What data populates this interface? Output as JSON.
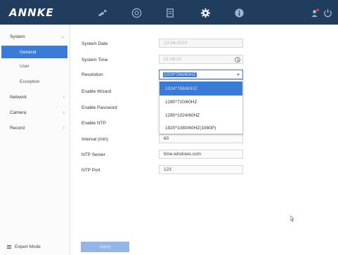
{
  "header": {
    "logo": "ANNKE",
    "icons": [
      "live-view-icon",
      "playback-icon",
      "file-icon",
      "settings-icon",
      "info-icon",
      "user-icon",
      "power-icon"
    ],
    "bg_color": "#203d5e",
    "active_icon": "settings-icon"
  },
  "sidebar": {
    "groups": [
      {
        "label": "System",
        "expanded": true
      },
      {
        "label": "Network",
        "expanded": false
      },
      {
        "label": "Camera",
        "expanded": false
      },
      {
        "label": "Record",
        "expanded": false
      }
    ],
    "system_items": [
      "General",
      "User",
      "Exception"
    ],
    "active_item": "General",
    "expert_mode": "Expert Mode",
    "accent": "#3a7bd5"
  },
  "form": {
    "system_date": {
      "label": "System Date",
      "value": "23-04-2020"
    },
    "system_time": {
      "label": "System Time",
      "value": "01:08:32"
    },
    "resolution": {
      "label": "Resolution",
      "value": "1024*768/60HZ"
    },
    "enable_wizard": {
      "label": "Enable Wizard"
    },
    "enable_password": {
      "label": "Enable Password"
    },
    "enable_ntp": {
      "label": "Enable NTP"
    },
    "interval": {
      "label": "Interval (min)",
      "value": "60"
    },
    "ntp_server": {
      "label": "NTP Server",
      "value": "time.windows.com"
    },
    "ntp_port": {
      "label": "NTP Port",
      "value": "123"
    },
    "apply_label": "Apply"
  },
  "resolution_options": [
    "1024*768/60HZ",
    "1280*720/60HZ",
    "1280*1024/60HZ",
    "1920*1080/60HZ(1080P)"
  ]
}
